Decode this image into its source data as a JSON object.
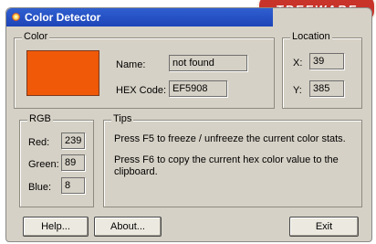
{
  "badge": {
    "text": "TREEWARE"
  },
  "window": {
    "title": "Color Detector"
  },
  "color_group": {
    "label": "Color",
    "swatch_color": "#ef5908",
    "name_label": "Name:",
    "name_value": "not found",
    "hex_label": "HEX Code:",
    "hex_value": "EF5908"
  },
  "location_group": {
    "label": "Location",
    "x_label": "X:",
    "x_value": "39",
    "y_label": "Y:",
    "y_value": "385"
  },
  "rgb_group": {
    "label": "RGB",
    "red_label": "Red:",
    "red_value": "239",
    "green_label": "Green:",
    "green_value": "89",
    "blue_label": "Blue:",
    "blue_value": "8"
  },
  "tips_group": {
    "label": "Tips",
    "tip1": "Press  F5  to freeze / unfreeze the current color stats.",
    "tip2": "Press  F6  to copy the current hex color value to the clipboard."
  },
  "buttons": {
    "help": "Help...",
    "about": "About...",
    "exit": "Exit"
  }
}
